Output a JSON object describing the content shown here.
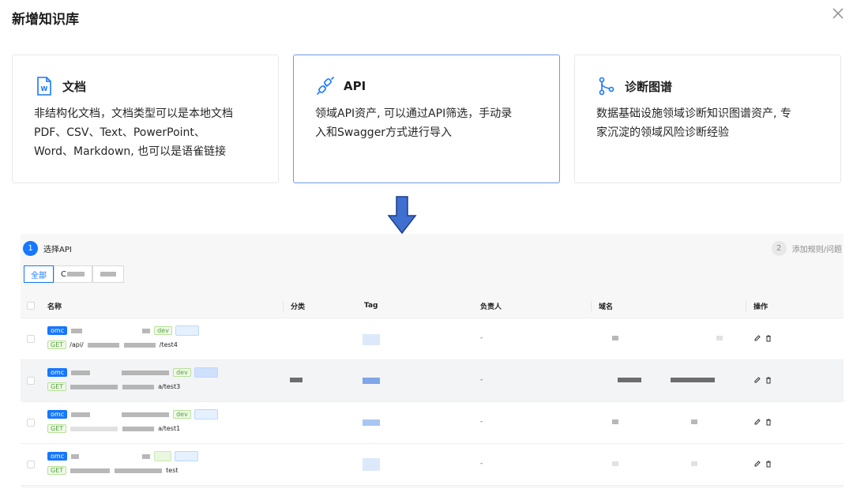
{
  "modal": {
    "title": "新增知识库"
  },
  "cards": [
    {
      "icon": "word-document-icon",
      "title": "文档",
      "desc_lines": [
        "非结构化文档，文档类型可以是本地文档",
        "PDF、CSV、Text、PowerPoint、",
        "Word、Markdown, 也可以是语雀链接"
      ],
      "selected": false
    },
    {
      "icon": "api-link-icon",
      "title": "API",
      "desc_lines": [
        "领域API资产, 可以通过API筛选，手动录",
        "入和Swagger方式进行导入"
      ],
      "selected": true
    },
    {
      "icon": "branch-graph-icon",
      "title": "诊断图谱",
      "desc_lines": [
        "数据基础设施领域诊断知识图谱资产, 专",
        "家沉淀的领域风险诊断经验"
      ],
      "selected": false
    }
  ],
  "steps": [
    {
      "num": "1",
      "label": "选择API",
      "active": true
    },
    {
      "num": "2",
      "label": "添加规则/问题",
      "active": false
    }
  ],
  "filter_tabs": [
    {
      "label": "全部",
      "active": true
    },
    {
      "label": "C",
      "active": false
    }
  ],
  "table": {
    "headers": [
      "名称",
      "分类",
      "Tag",
      "负责人",
      "域名",
      "操作"
    ],
    "rows": [
      {
        "tag": "omc",
        "method": "GET",
        "path_prefix": "/api/",
        "path_suffix": "/test4",
        "env": "dev",
        "owner": "-"
      },
      {
        "tag": "omc",
        "method": "GET",
        "path_prefix": "",
        "path_suffix": "a/test3",
        "env": "dev",
        "owner": "-"
      },
      {
        "tag": "omc",
        "method": "GET",
        "path_prefix": "",
        "path_suffix": "a/test1",
        "env": "dev",
        "owner": "-"
      },
      {
        "tag": "omc",
        "method": "GET",
        "path_prefix": "",
        "path_suffix": "test",
        "env": "",
        "owner": "-"
      }
    ]
  },
  "colors": {
    "accent": "#1677ff",
    "selected_border": "#6e9ae8",
    "arrow": "#3f6fcf"
  }
}
